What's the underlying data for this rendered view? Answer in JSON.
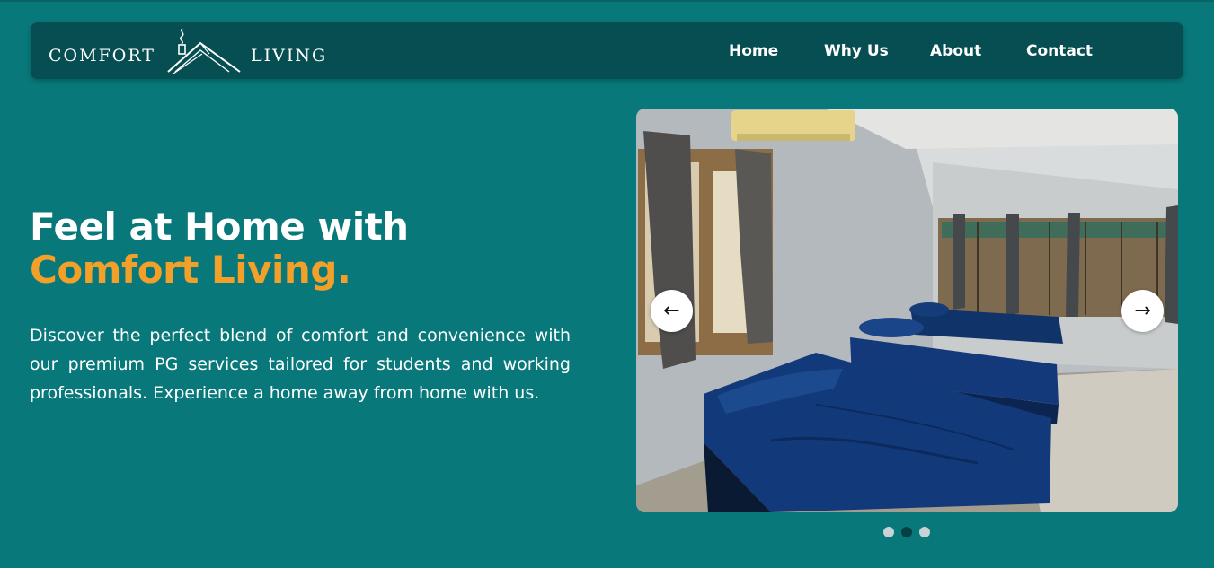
{
  "brand": {
    "left_word": "COMFORT",
    "right_word": "LIVING",
    "logo_icon": "house-roof-icon"
  },
  "nav": {
    "items": [
      {
        "label": "Home"
      },
      {
        "label": "Why Us"
      },
      {
        "label": "About"
      },
      {
        "label": "Contact"
      }
    ]
  },
  "hero": {
    "title_line1": "Feel at Home with",
    "title_line2": "Comfort Living.",
    "description": "Discover the perfect blend of comfort and convenience with our premium PG services tailored for students and working professionals. Experience a home away from home with us."
  },
  "carousel": {
    "image": "room-with-blue-beds-photo",
    "prev_icon": "arrow-left-icon",
    "next_icon": "arrow-right-icon",
    "prev_glyph": "←",
    "next_glyph": "→",
    "slide_count": 3,
    "active_slide": 2
  },
  "colors": {
    "background": "#08787a",
    "navbar": "#064e52",
    "accent": "#f2a02a",
    "text": "#ffffff"
  }
}
